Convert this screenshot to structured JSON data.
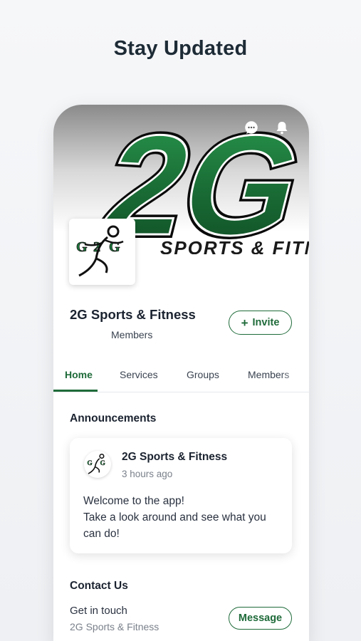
{
  "headline": "Stay Updated",
  "colors": {
    "accent": "#1f6b3a",
    "brand_green": "#1e7a3d",
    "text_dark": "#1b2330",
    "text_muted": "#7a818b"
  },
  "cover": {
    "logo_text": "2G",
    "logo_subtext": "SPORTS & FITNESS",
    "icons": [
      "chat-icon",
      "bell-icon"
    ]
  },
  "group": {
    "name": "2G Sports & Fitness",
    "members_label": "Members",
    "invite_label": "Invite"
  },
  "tabs": [
    {
      "label": "Home",
      "active": true
    },
    {
      "label": "Services",
      "active": false
    },
    {
      "label": "Groups",
      "active": false
    },
    {
      "label": "Members",
      "active": false
    }
  ],
  "announcements": {
    "title": "Announcements",
    "post": {
      "author": "2G Sports & Fitness",
      "time": "3 hours ago",
      "lines": [
        "Welcome to the app!",
        "Take a look around and see what you can do!"
      ]
    }
  },
  "contact": {
    "title": "Contact Us",
    "line1": "Get in touch",
    "line2": "2G Sports & Fitness",
    "message_label": "Message"
  }
}
